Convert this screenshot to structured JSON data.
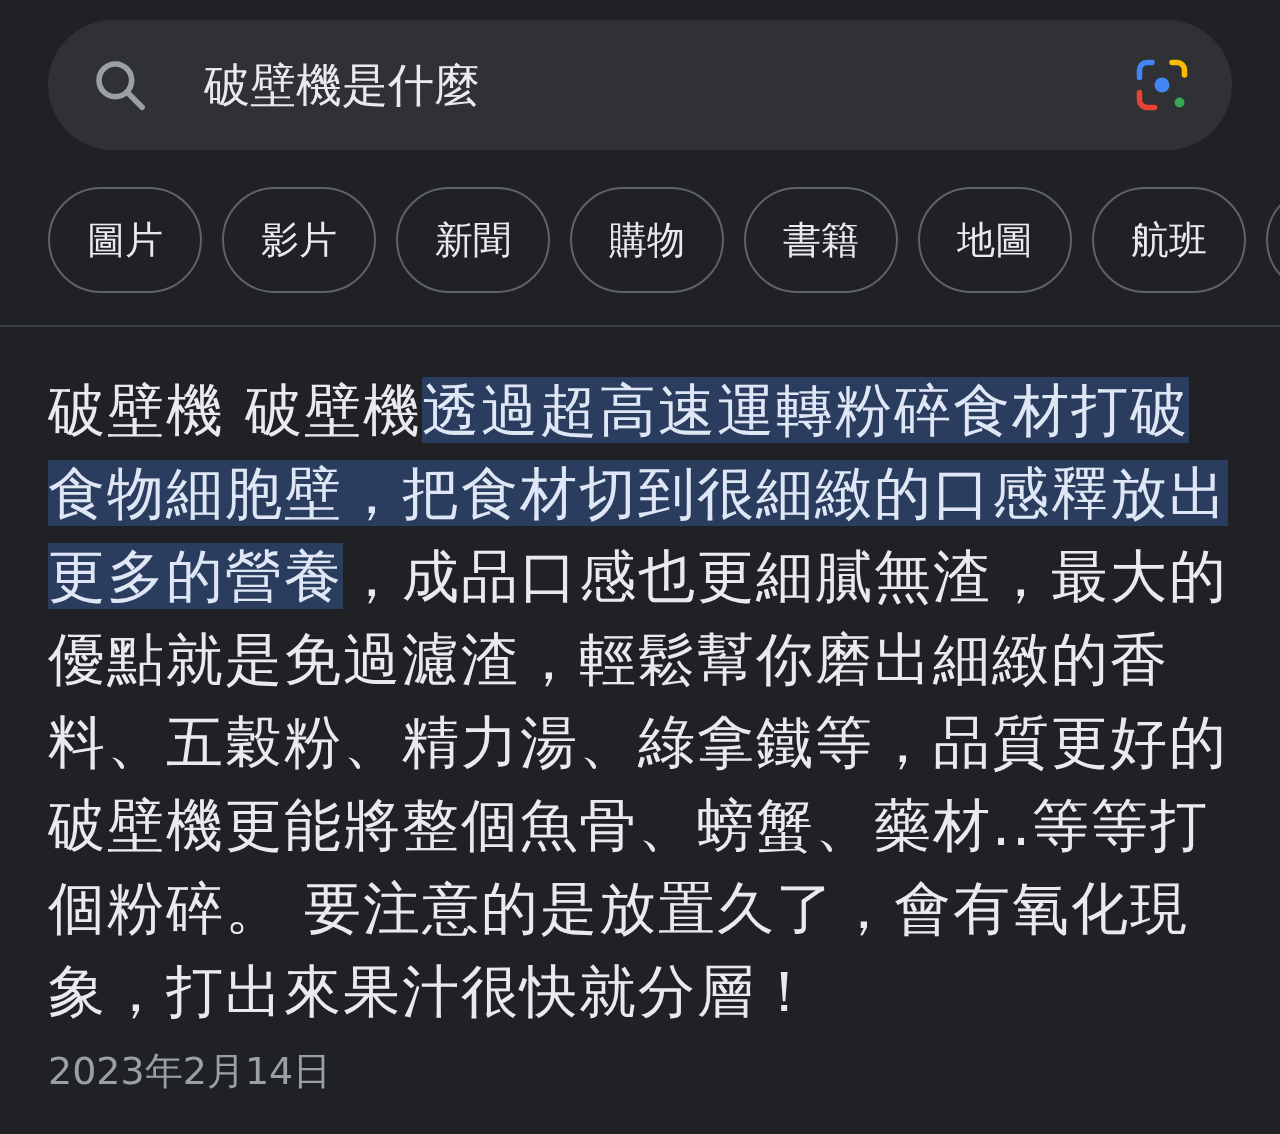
{
  "search": {
    "query": "破壁機是什麼"
  },
  "chips": [
    {
      "label": "圖片"
    },
    {
      "label": "影片"
    },
    {
      "label": "新聞"
    },
    {
      "label": "購物"
    },
    {
      "label": "書籍"
    },
    {
      "label": "地圖"
    },
    {
      "label": "航班"
    }
  ],
  "snippet": {
    "segments": [
      {
        "text": "破壁機 破壁機",
        "highlighted": false
      },
      {
        "text": "透過超高速運轉粉碎食材打破食物細胞壁，把食材切到很細緻的口感釋放出更多的營養",
        "highlighted": true
      },
      {
        "text": "，成品口感也更細膩無渣，最大的優點就是免過濾渣，輕鬆幫你磨出細緻的香料、五穀粉、精力湯、綠拿鐵等，品質更好的破壁機更能將整個魚骨、螃蟹、藥材..等等打個粉碎。 要注意的是放置久了，會有氧化現象，打出來果汁很快就分層！",
        "highlighted": false
      }
    ],
    "date": "2023年2月14日"
  }
}
